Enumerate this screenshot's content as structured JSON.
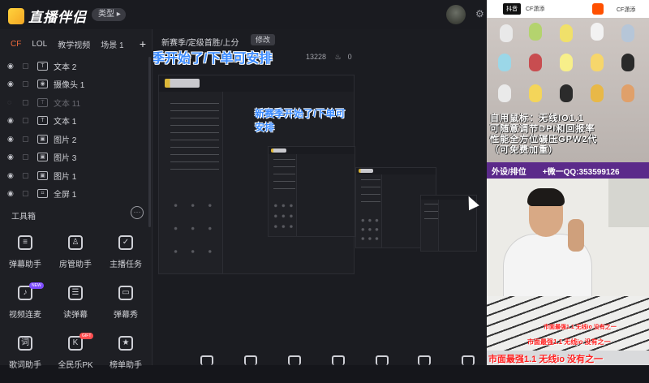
{
  "app": {
    "brand": "直播伴侣",
    "type_button": "类型"
  },
  "scene_tabs": [
    "CF",
    "LOL",
    "教学视频",
    "场景 1"
  ],
  "layers": [
    {
      "name": "文本 2",
      "kind": "T",
      "visible": true
    },
    {
      "name": "摄像头 1",
      "kind": "◉",
      "visible": true
    },
    {
      "name": "文本 11",
      "kind": "T",
      "visible": false
    },
    {
      "name": "文本 1",
      "kind": "T",
      "visible": true
    },
    {
      "name": "图片 2",
      "kind": "▣",
      "visible": true
    },
    {
      "name": "图片 3",
      "kind": "▣",
      "visible": true
    },
    {
      "name": "图片 1",
      "kind": "▣",
      "visible": true
    },
    {
      "name": "全屏 1",
      "kind": "⌗",
      "visible": true
    }
  ],
  "toolbox": {
    "title": "工具箱",
    "items": [
      {
        "label": "弹幕助手",
        "icon": "danmu-assistant-icon",
        "badge": ""
      },
      {
        "label": "房管助手",
        "icon": "room-manager-icon",
        "badge": ""
      },
      {
        "label": "主播任务",
        "icon": "task-icon",
        "badge": ""
      },
      {
        "label": "视频连麦",
        "icon": "video-mic-icon",
        "badge": "NEW"
      },
      {
        "label": "读弹幕",
        "icon": "read-danmu-icon",
        "badge": ""
      },
      {
        "label": "弹幕秀",
        "icon": "danmu-show-icon",
        "badge": ""
      },
      {
        "label": "歌词助手",
        "icon": "lyrics-icon",
        "badge": ""
      },
      {
        "label": "全民乐PK",
        "icon": "pk-icon",
        "badge": "GIFT"
      },
      {
        "label": "榜单助手",
        "icon": "ranking-icon",
        "badge": ""
      }
    ]
  },
  "preview": {
    "title": "新赛季/定级首胜/上分",
    "edit": "修改",
    "overlay": "新赛季开始了/下单可安排",
    "viewers": "13228",
    "likes": "0"
  },
  "stream": {
    "platform": "抖音",
    "channel": "CF潇添",
    "channel2": "CF潇添",
    "promo_lines": [
      "自用鼠标：无线IO1.1",
      "可随意调节DPI和回报率",
      "性能全方位碾压GPW2代",
      "（可免费加重）"
    ],
    "purple_left": "外设/排位",
    "purple_right": "+微一QQ:353599126",
    "red_lines": [
      "市面最强1.1 无线io 没有之一",
      "市面最强1.1 无线io 没有之一",
      "市面最强1.1 无线io 没有之一"
    ]
  },
  "colors": {
    "accent": "#f06a3b",
    "overlay_blue": "#3b8bff",
    "purple": "#5b2a8a",
    "red": "#ff2020"
  }
}
